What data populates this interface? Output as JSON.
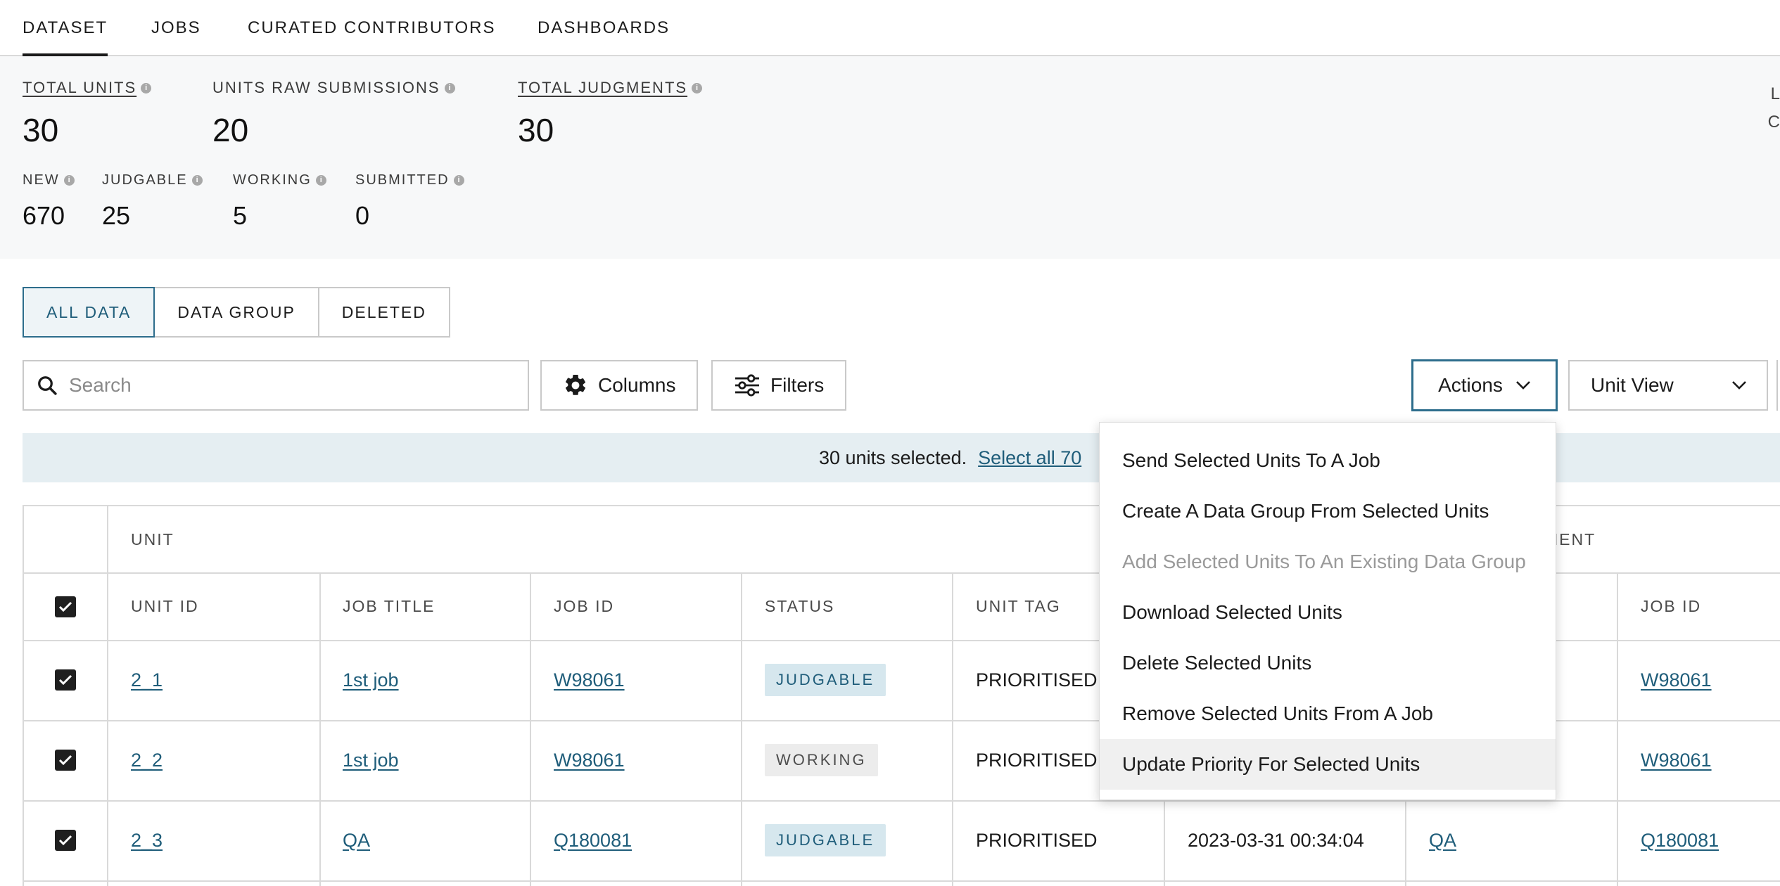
{
  "nav": {
    "tabs": [
      "DATASET",
      "JOBS",
      "CURATED CONTRIBUTORS",
      "DASHBOARDS"
    ],
    "active": "DATASET"
  },
  "stats": {
    "total_units": {
      "label": "TOTAL UNITS",
      "value": "30"
    },
    "units_raw_submissions": {
      "label": "UNITS RAW SUBMISSIONS",
      "value": "20"
    },
    "total_judgments": {
      "label": "TOTAL JUDGMENTS",
      "value": "30"
    },
    "new": {
      "label": "NEW",
      "value": "670"
    },
    "judgable": {
      "label": "JUDGABLE",
      "value": "25"
    },
    "working": {
      "label": "WORKING",
      "value": "5"
    },
    "submitted": {
      "label": "SUBMITTED",
      "value": "0"
    },
    "info_glyph": "i",
    "edge_fragment_1": "L",
    "edge_fragment_2": "C"
  },
  "segments": [
    "ALL DATA",
    "DATA GROUP",
    "DELETED"
  ],
  "toolbar": {
    "search_placeholder": "Search",
    "columns_label": "Columns",
    "filters_label": "Filters",
    "actions_label": "Actions",
    "unit_view_label": "Unit View"
  },
  "banner": {
    "text": "30 units selected.",
    "link": "Select all 70"
  },
  "table": {
    "group_headers": {
      "unit": "UNIT",
      "judgment": "MENT"
    },
    "columns": {
      "unit_id": "UNIT ID",
      "job_title": "JOB TITLE",
      "job_id": "JOB ID",
      "status": "STATUS",
      "unit_tag": "UNIT TAG",
      "job_id_2": "JOB ID"
    },
    "rows": [
      {
        "unit_id": "2_1",
        "job_title": "1st job",
        "job_id": "W98061",
        "status": "JUDGABLE",
        "status_kind": "judgable",
        "unit_tag": "PRIORITISED",
        "created": "",
        "j_job_title": "",
        "j_job_id": "W98061"
      },
      {
        "unit_id": "2_2",
        "job_title": "1st job",
        "job_id": "W98061",
        "status": "WORKING",
        "status_kind": "working",
        "unit_tag": "PRIORITISED",
        "created": "",
        "j_job_title": "",
        "j_job_id": "W98061"
      },
      {
        "unit_id": "2_3",
        "job_title": "QA",
        "job_id": "Q180081",
        "status": "JUDGABLE",
        "status_kind": "judgable",
        "unit_tag": "PRIORITISED",
        "created": "2023-03-31 00:34:04",
        "j_job_title": "QA",
        "j_job_id": "Q180081"
      }
    ]
  },
  "actions_menu": {
    "items": [
      {
        "label": "Send Selected Units To A Job",
        "disabled": false,
        "hovered": false
      },
      {
        "label": "Create A Data Group From Selected Units",
        "disabled": false,
        "hovered": false
      },
      {
        "label": "Add Selected Units To An Existing Data Group",
        "disabled": true,
        "hovered": false
      },
      {
        "label": "Download Selected Units",
        "disabled": false,
        "hovered": false
      },
      {
        "label": "Delete Selected Units",
        "disabled": false,
        "hovered": false
      },
      {
        "label": "Remove Selected Units From A Job",
        "disabled": false,
        "hovered": false
      },
      {
        "label": "Update Priority For Selected Units",
        "disabled": false,
        "hovered": true
      }
    ]
  },
  "colors": {
    "accent": "#2d6d8c",
    "link": "#1f5d7a",
    "banner_bg": "#e5eef2",
    "stats_bg": "#f7f8f9"
  }
}
